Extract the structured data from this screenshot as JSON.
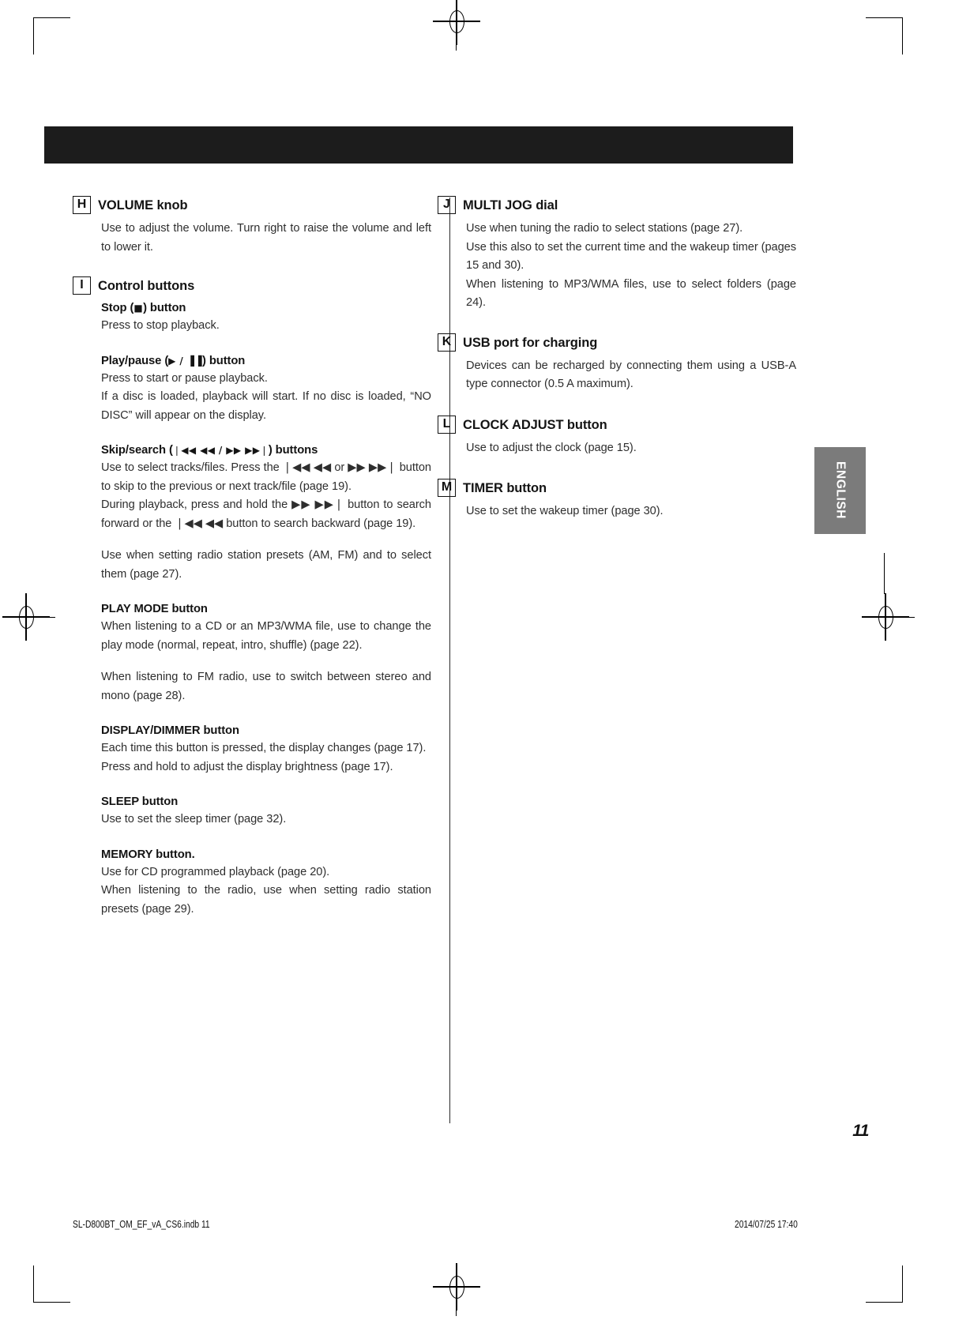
{
  "page": {
    "number": "11",
    "language_tab": "ENGLISH"
  },
  "footer": {
    "file": "SL-D800BT_OM_EF_vA_CS6.indb   11",
    "timestamp": "2014/07/25   17:40"
  },
  "left_column": {
    "items": [
      {
        "letter": "H",
        "title": "VOLUME knob",
        "paragraphs": [
          "Use to adjust the volume. Turn right to raise the volume and left to lower it."
        ]
      },
      {
        "letter": "I",
        "title": "Control buttons",
        "subsections": [
          {
            "title_prefix": "Stop (",
            "title_glyph": "■",
            "title_suffix": ") button",
            "paragraphs": [
              "Press to stop playback."
            ]
          },
          {
            "title_prefix": "Play/pause (",
            "title_glyph": "▶ / ▐▐",
            "title_suffix": ") button",
            "paragraphs": [
              "Press to start or pause playback.",
              "If a disc is loaded, playback will start. If no disc is loaded, “NO DISC” will appear on the display."
            ]
          },
          {
            "title_prefix": "Skip/search (",
            "title_glyph": "❘◀◀ ◀◀ / ▶▶ ▶▶❘",
            "title_suffix": ") buttons",
            "paragraphs": [
              "Use to select tracks/files. Press the ❘◀◀ ◀◀  or ▶▶ ▶▶❘ button to skip to the previous or next track/file (page 19).",
              "During playback, press and hold the ▶▶ ▶▶❘ button to search forward or the ❘◀◀ ◀◀ button to search backward (page 19).",
              "Use when setting radio station presets (AM, FM) and to select them (page 27)."
            ]
          },
          {
            "title_prefix": "PLAY MODE button",
            "title_glyph": "",
            "title_suffix": "",
            "paragraphs": [
              "When listening to a CD or an MP3/WMA file, use to change the play mode (normal, repeat, intro, shuffle) (page 22).",
              "When listening to FM radio, use to switch between stereo and mono (page 28)."
            ]
          },
          {
            "title_prefix": "DISPLAY/DIMMER button",
            "title_glyph": "",
            "title_suffix": "",
            "paragraphs": [
              "Each time this button is pressed, the display changes (page 17).",
              "Press and hold to adjust the display brightness (page 17)."
            ]
          },
          {
            "title_prefix": "SLEEP button",
            "title_glyph": "",
            "title_suffix": "",
            "paragraphs": [
              "Use to set the sleep timer (page 32)."
            ]
          },
          {
            "title_prefix": "MEMORY button.",
            "title_glyph": "",
            "title_suffix": "",
            "paragraphs": [
              "Use for CD programmed playback (page 20).",
              "When listening to the radio, use when setting radio station presets (page 29)."
            ]
          }
        ]
      }
    ]
  },
  "right_column": {
    "items": [
      {
        "letter": "J",
        "title": "MULTI JOG dial",
        "paragraphs": [
          "Use when tuning the radio to select stations (page 27).",
          "Use this also to set the current time and the wakeup timer (pages 15 and 30).",
          "When listening to MP3/WMA files, use to select folders (page 24)."
        ]
      },
      {
        "letter": "K",
        "title": "USB port for charging",
        "paragraphs": [
          "Devices can be recharged by connecting them using a USB-A type connector (0.5 A maximum)."
        ]
      },
      {
        "letter": "L",
        "title": "CLOCK ADJUST button",
        "paragraphs": [
          "Use to adjust the clock (page 15)."
        ]
      },
      {
        "letter": "M",
        "title": "TIMER button",
        "paragraphs": [
          "Use to set the wakeup timer (page 30)."
        ]
      }
    ]
  }
}
